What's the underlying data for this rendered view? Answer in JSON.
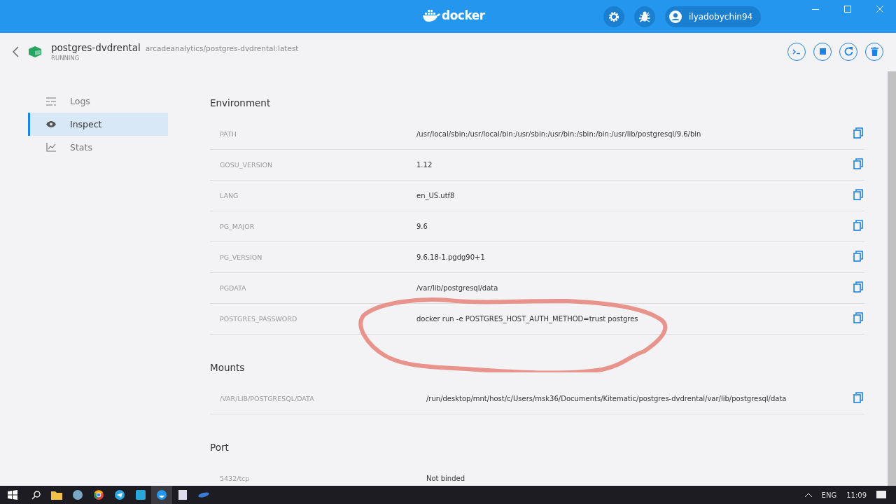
{
  "window": {
    "brand": "docker",
    "user": "ilyadobychin94"
  },
  "container": {
    "name": "postgres-dvdrental",
    "image": "arcadeanalytics/postgres-dvdrental:latest",
    "status": "RUNNING"
  },
  "sidebar": {
    "items": [
      {
        "label": "Logs",
        "kind": "logs",
        "selected": false
      },
      {
        "label": "Inspect",
        "kind": "inspect",
        "selected": true
      },
      {
        "label": "Stats",
        "kind": "stats",
        "selected": false
      }
    ]
  },
  "sections": [
    {
      "title": "Environment",
      "rows": [
        {
          "key": "PATH",
          "value": "/usr/local/sbin:/usr/local/bin:/usr/sbin:/usr/bin:/sbin:/bin:/usr/lib/postgresql/9.6/bin",
          "copyable": true
        },
        {
          "key": "GOSU_VERSION",
          "value": "1.12",
          "copyable": true
        },
        {
          "key": "LANG",
          "value": "en_US.utf8",
          "copyable": true
        },
        {
          "key": "PG_MAJOR",
          "value": "9.6",
          "copyable": true
        },
        {
          "key": "PG_VERSION",
          "value": "9.6.18-1.pgdg90+1",
          "copyable": true
        },
        {
          "key": "PGDATA",
          "value": "/var/lib/postgresql/data",
          "copyable": true
        },
        {
          "key": "POSTGRES_PASSWORD",
          "value": "docker run -e POSTGRES_HOST_AUTH_METHOD=trust postgres",
          "copyable": true
        }
      ]
    },
    {
      "title": "Mounts",
      "rows": [
        {
          "key": "/VAR/LIB/POSTGRESQL/DATA",
          "value": "/run/desktop/mnt/host/c/Users/msk36/Documents/Kitematic/postgres-dvdrental/var/lib/postgresql/data",
          "copyable": true
        }
      ]
    },
    {
      "title": "Port",
      "rows": [
        {
          "key": "5432/tcp",
          "value": "Not binded",
          "copyable": false
        }
      ]
    }
  ],
  "taskbar": {
    "language": "ENG",
    "time": "11:09"
  }
}
